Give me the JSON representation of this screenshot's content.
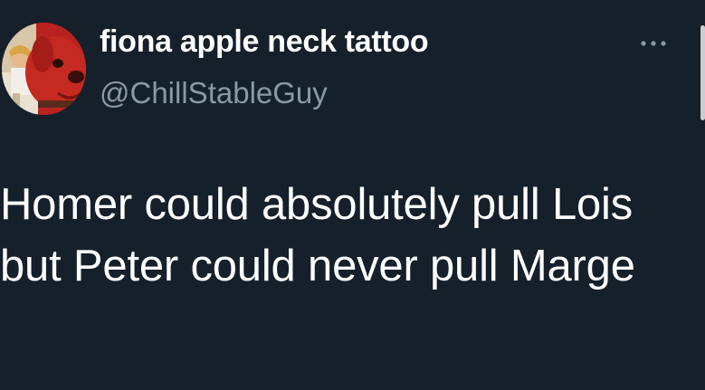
{
  "tweet": {
    "author": {
      "display_name": "fiona apple neck tattoo",
      "handle": "@ChillStableGuy",
      "avatar_icon": "avatar-red-dog-icon"
    },
    "text": "Homer could absolutely pull Lois but Peter could never pull Marge",
    "more_icon": "more-options-icon"
  },
  "colors": {
    "background": "#15202b",
    "text_primary": "#ffffff",
    "text_secondary": "#8b98a5"
  }
}
